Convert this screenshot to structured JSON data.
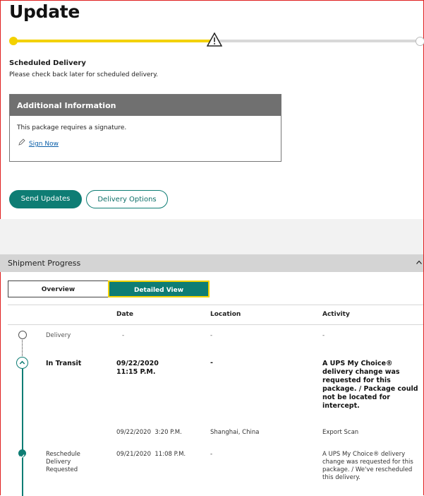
{
  "page": {
    "title": "Update"
  },
  "progress": {
    "fraction": 0.5,
    "accent": "#f3d100",
    "status_icon": "warning-triangle-icon"
  },
  "scheduled": {
    "title": "Scheduled Delivery",
    "text": "Please check back later for scheduled delivery."
  },
  "additional_info": {
    "title": "Additional Information",
    "text": "This package requires a signature.",
    "sign_icon": "pencil-icon",
    "sign_label": "Sign Now"
  },
  "buttons": {
    "send_updates": "Send Updates",
    "delivery_options": "Delivery Options"
  },
  "shipment_progress": {
    "label": "Shipment Progress",
    "tabs": [
      {
        "label": "Overview",
        "selected": false
      },
      {
        "label": "Detailed View",
        "selected": true
      }
    ],
    "columns": {
      "date": "Date",
      "location": "Location",
      "activity": "Activity"
    },
    "rows": [
      {
        "status": "Delivery",
        "date": "-",
        "location": "-",
        "activity": "-"
      },
      {
        "status": "In Transit",
        "date_line1": "09/22/2020",
        "date_line2": "11:15 P.M.",
        "location": "-",
        "activity_lines": [
          "A UPS My Choice®",
          "delivery change was",
          "requested for this",
          "package. / Package could",
          "not be located for",
          "intercept."
        ]
      },
      {
        "status": "",
        "date": "09/22/2020  3:20 P.M.",
        "location": "Shanghai, China",
        "activity": "Export Scan"
      },
      {
        "status_lines": [
          "Reschedule",
          "Delivery",
          "Requested"
        ],
        "date": "09/21/2020  11:08 P.M.",
        "location": "-",
        "activity_lines": [
          "A UPS My Choice® delivery",
          "change was requested for this",
          "package. / We've rescheduled",
          "this delivery."
        ]
      }
    ]
  },
  "colors": {
    "brand_teal": "#0e7d74",
    "header_gray": "#707070"
  }
}
